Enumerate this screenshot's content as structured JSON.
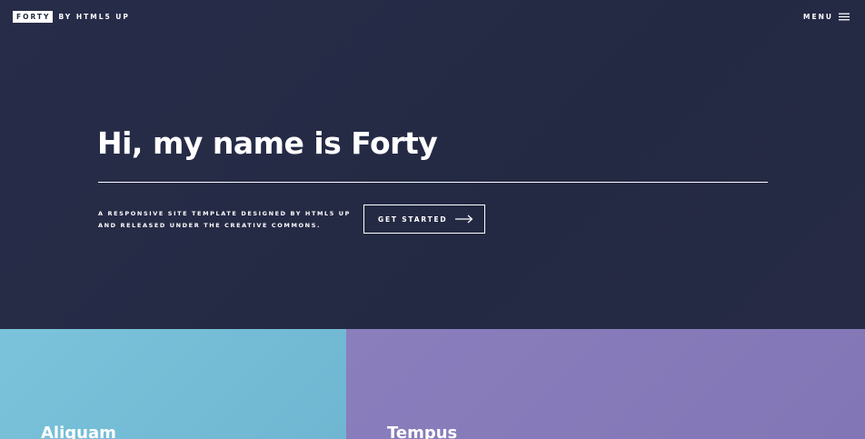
{
  "header": {
    "logo_box": "FORTY",
    "logo_rest": "BY HTML5 UP",
    "menu_label": "MENU"
  },
  "banner": {
    "title": "Hi, my name is Forty",
    "tagline_line1": "A RESPONSIVE SITE TEMPLATE DESIGNED BY HTML5 UP",
    "tagline_line2": "AND RELEASED UNDER THE CREATIVE COMMONS.",
    "cta_label": "GET STARTED"
  },
  "tiles": [
    {
      "title": "Aliquam",
      "color": "#75bcd7"
    },
    {
      "title": "Tempus",
      "color": "#867aba"
    }
  ],
  "colors": {
    "background": "#242943",
    "text": "#ffffff"
  },
  "icons": {
    "menu": "hamburger-menu-icon",
    "cta": "arrow-right-icon"
  }
}
